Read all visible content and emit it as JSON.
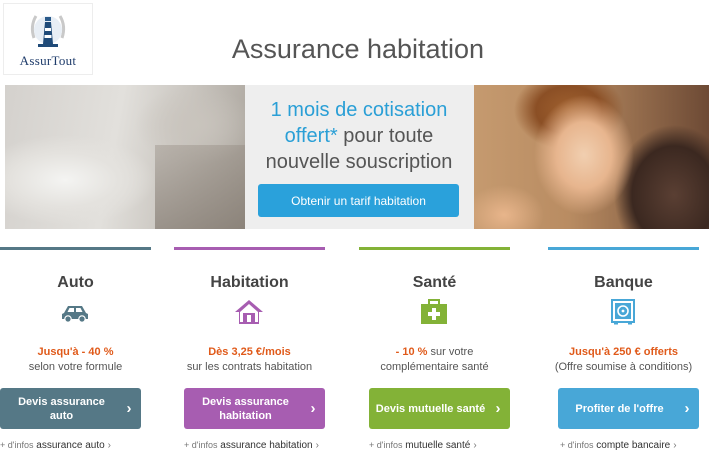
{
  "brand": {
    "name": "AssurTout",
    "logo_icon": "lighthouse-icon"
  },
  "page_title": "Assurance habitation",
  "hero": {
    "highlight": "1 mois de cotisation offert*",
    "text_rest": "pour toute nouvelle souscription",
    "cta_label": "Obtenir un tarif habitation"
  },
  "colors": {
    "auto": "#557886",
    "habitation": "#a75db1",
    "sante": "#83b237",
    "banque": "#48a7d7",
    "accent": "#e05a1a",
    "hero_cta": "#2aa1db"
  },
  "cards": [
    {
      "title": "Auto",
      "icon": "car-icon",
      "accent": "Jusqu'à - 40 %",
      "text": "",
      "line2": "selon votre formule",
      "button": "Devis assurance auto",
      "info_prefix": "+ d'infos",
      "info_link": "assurance auto"
    },
    {
      "title": "Habitation",
      "icon": "house-icon",
      "accent": "Dès 3,25 €/mois",
      "text": "",
      "line2": "sur les contrats habitation",
      "button": "Devis assurance habitation",
      "info_prefix": "+ d'infos",
      "info_link": "assurance habitation"
    },
    {
      "title": "Santé",
      "icon": "first-aid-kit-icon",
      "accent": "- 10 %",
      "text": " sur votre",
      "line2": "complémentaire santé",
      "button": "Devis mutuelle santé",
      "info_prefix": "+ d'infos",
      "info_link": "mutuelle santé"
    },
    {
      "title": "Banque",
      "icon": "safe-icon",
      "accent": "Jusqu'à 250 € offerts",
      "text": "",
      "line2": "(Offre soumise à conditions)",
      "button": "Profiter de l'offre",
      "info_prefix": "+ d'infos",
      "info_link": "compte bancaire"
    }
  ]
}
